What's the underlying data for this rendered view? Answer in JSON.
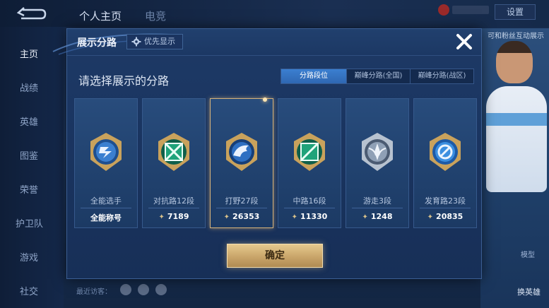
{
  "background": {
    "tabs": [
      "个人主页",
      "电竞"
    ],
    "settings_label": "设置",
    "nav_items": [
      "主页",
      "战绩",
      "英雄",
      "图鉴",
      "荣誉",
      "护卫队",
      "游戏",
      "社交"
    ],
    "active_nav": "主页",
    "recent_visitors_label": "最近访客：",
    "hero_note": "可和粉丝互动展示",
    "hero_label_model": "模型",
    "hero_label_switch": "换英雄"
  },
  "modal": {
    "title": "展示分路",
    "priority_label": "优先显示",
    "close_icon": "close-icon",
    "subtitle": "请选择展示的分路",
    "tabs": [
      {
        "label": "分路段位",
        "active": true
      },
      {
        "label": "巅峰分路(全国)",
        "active": false
      },
      {
        "label": "巅峰分路(战区)",
        "active": false
      }
    ],
    "cards": [
      {
        "name": "全能选手",
        "value": "全能称号",
        "icon": "all-round-badge-icon",
        "color": "#3b7fd0",
        "has_triangle": false,
        "selected": false
      },
      {
        "name": "对抗路12段",
        "value": "7189",
        "icon": "clash-lane-badge-icon",
        "color": "#1fa37a",
        "has_triangle": true,
        "selected": false
      },
      {
        "name": "打野27段",
        "value": "26353",
        "icon": "jungle-badge-icon",
        "color": "#2e6fc2",
        "has_triangle": true,
        "selected": true
      },
      {
        "name": "中路16段",
        "value": "11330",
        "icon": "mid-lane-badge-icon",
        "color": "#1fa37a",
        "has_triangle": true,
        "selected": false
      },
      {
        "name": "游走3段",
        "value": "1248",
        "icon": "roam-badge-icon",
        "color": "#8fa0b6",
        "has_triangle": true,
        "selected": false
      },
      {
        "name": "发育路23段",
        "value": "20835",
        "icon": "farm-lane-badge-icon",
        "color": "#3b8fe0",
        "has_triangle": true,
        "selected": false
      }
    ],
    "confirm_label": "确定"
  }
}
